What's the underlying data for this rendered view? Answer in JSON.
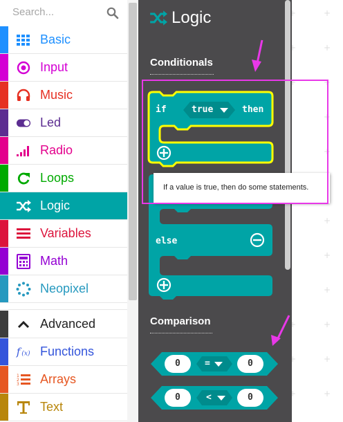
{
  "search": {
    "placeholder": "Search..."
  },
  "categories": [
    {
      "label": "Basic",
      "color": "#1e90ff",
      "icon": "grid-icon"
    },
    {
      "label": "Input",
      "color": "#d400d4",
      "icon": "target-icon"
    },
    {
      "label": "Music",
      "color": "#e63022",
      "icon": "headphones-icon"
    },
    {
      "label": "Led",
      "color": "#5c2d91",
      "icon": "toggle-icon"
    },
    {
      "label": "Radio",
      "color": "#e3008c",
      "icon": "signal-bars-icon"
    },
    {
      "label": "Loops",
      "color": "#00aa00",
      "icon": "refresh-icon"
    },
    {
      "label": "Logic",
      "color": "#00a4a6",
      "icon": "shuffle-icon"
    },
    {
      "label": "Variables",
      "color": "#dc143c",
      "icon": "list-lines-icon"
    },
    {
      "label": "Math",
      "color": "#9400d3",
      "icon": "calculator-icon"
    },
    {
      "label": "Neopixel",
      "color": "#2699bf",
      "icon": "dotted-circle-icon"
    },
    {
      "label": "Advanced",
      "color": "#3c3c3c",
      "icon": "chevron-up-icon"
    },
    {
      "label": "Functions",
      "color": "#3455db",
      "icon": "function-icon"
    },
    {
      "label": "Arrays",
      "color": "#e65722",
      "icon": "numbered-list-icon"
    },
    {
      "label": "Text",
      "color": "#b8860b",
      "icon": "text-t-icon"
    }
  ],
  "selected_category": "Logic",
  "flyout": {
    "title": "Logic",
    "sections": {
      "conditionals": "Conditionals",
      "comparison": "Comparison"
    },
    "if_block": {
      "if": "if",
      "value": "true",
      "then": "then",
      "else": "else"
    },
    "tooltip": "If a value is true, then do some statements.",
    "compare_eq": {
      "left": "0",
      "op": "=",
      "right": "0"
    },
    "compare_lt": {
      "left": "0",
      "op": "<",
      "right": "0"
    }
  },
  "colors": {
    "logic": "#00a4a6",
    "flyout_bg": "#4b4a4c",
    "highlight": "#ffff00",
    "annotation": "#e838e8"
  }
}
